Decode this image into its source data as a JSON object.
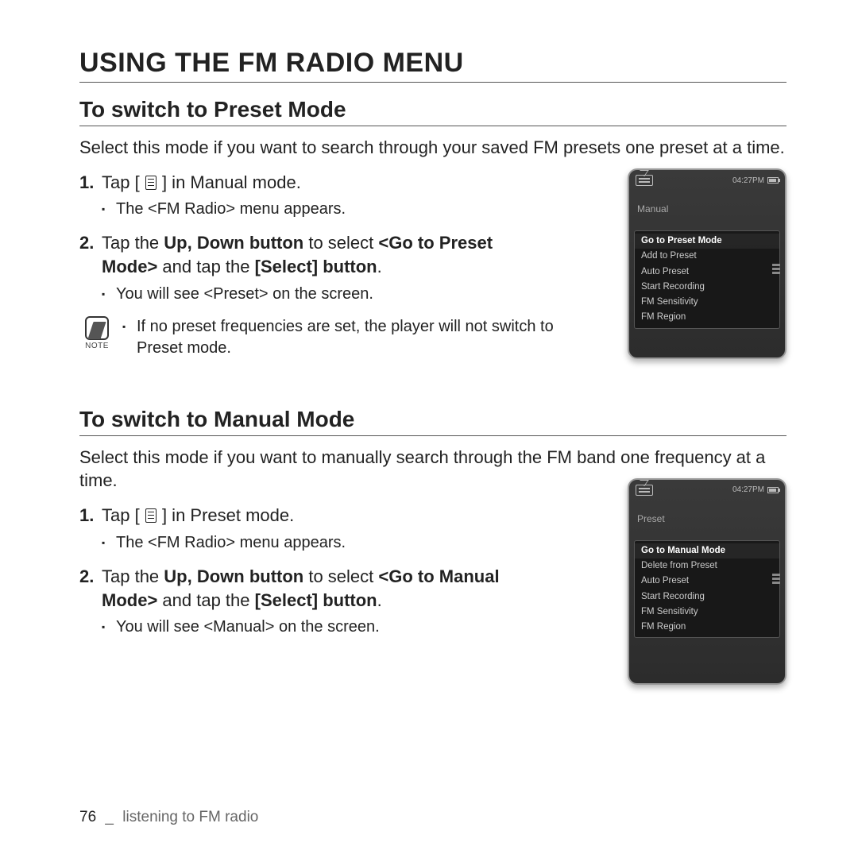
{
  "page": {
    "title": "USING THE FM RADIO MENU",
    "footer_page": "76",
    "footer_sep": "_",
    "footer_chapter": "listening to FM radio"
  },
  "note_label": "NOTE",
  "section1": {
    "heading": "To switch to Preset Mode",
    "intro": "Select this mode if you want to search through your saved FM presets one preset at a time.",
    "step1_pre": "Tap [",
    "step1_post": "] in Manual mode.",
    "step1_sub": "The <FM Radio> menu appears.",
    "step2_a": "Tap the ",
    "step2_b": "Up, Down button",
    "step2_c": " to select ",
    "step2_d": "<Go to Preset Mode>",
    "step2_e": " and tap the ",
    "step2_f": "[Select] button",
    "step2_g": ".",
    "step2_sub": "You will see <Preset> on the screen.",
    "note": "If no preset frequencies are set, the player will not switch to Preset mode.",
    "device": {
      "time": "04:27PM",
      "mode": "Manual",
      "menu": [
        "Go to Preset Mode",
        "Add to Preset",
        "Auto Preset",
        "Start Recording",
        "FM Sensitivity",
        "FM Region"
      ]
    }
  },
  "section2": {
    "heading": "To switch to Manual Mode",
    "intro": "Select this mode if you want to manually search through the FM band one frequency at a time.",
    "step1_pre": "Tap [",
    "step1_post": "] in Preset mode.",
    "step1_sub": "The <FM Radio> menu appears.",
    "step2_a": "Tap the ",
    "step2_b": "Up, Down button",
    "step2_c": " to select ",
    "step2_d": "<Go to Manual Mode>",
    "step2_e": " and tap the ",
    "step2_f": "[Select] button",
    "step2_g": ".",
    "step2_sub": "You will see <Manual> on the screen.",
    "device": {
      "time": "04:27PM",
      "mode": "Preset",
      "menu": [
        "Go to Manual Mode",
        "Delete from Preset",
        "Auto Preset",
        "Start Recording",
        "FM Sensitivity",
        "FM Region"
      ]
    }
  }
}
